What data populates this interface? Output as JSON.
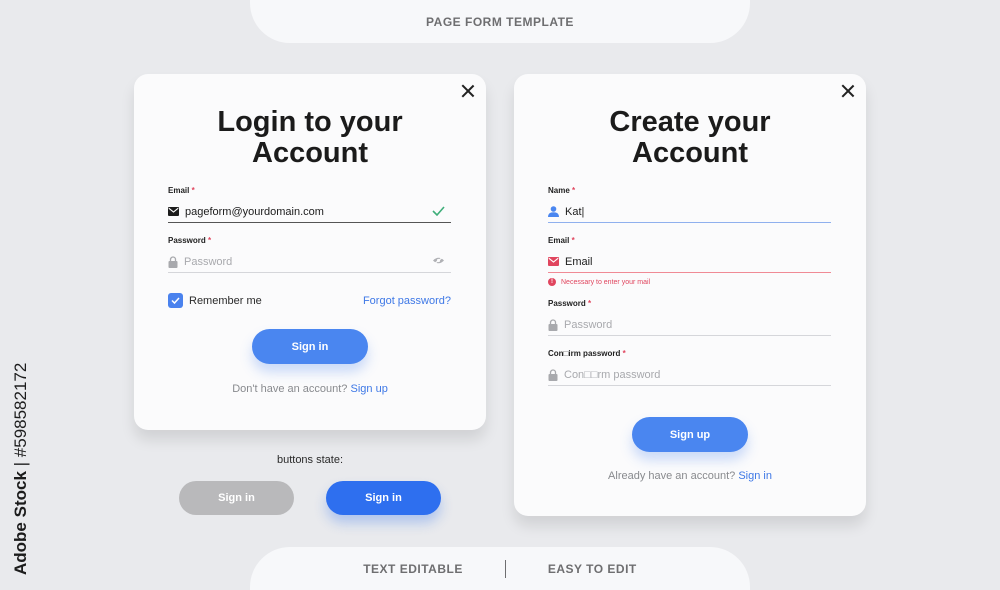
{
  "banners": {
    "top": "PAGE FORM TEMPLATE",
    "bottom_left": "TEXT EDITABLE",
    "bottom_right": "EASY TO EDIT"
  },
  "side_text": {
    "brand": "Adobe Stock",
    "id": "| #598582172"
  },
  "login": {
    "title_line1": "Login to your",
    "title_line2": "Account",
    "email_label": "Email",
    "email_value": "pageform@yourdomain.com",
    "password_label": "Password",
    "password_placeholder": "Password",
    "remember_label": "Remember me",
    "forgot_label": "Forgot password?",
    "signin_label": "Sign in",
    "footer_text": "Don't have an account?",
    "footer_link": "Sign up"
  },
  "buttons_state": {
    "label": "buttons state:",
    "disabled_label": "Sign in",
    "active_label": "Sign in"
  },
  "signup": {
    "title_line1": "Create your",
    "title_line2": "Account",
    "name_label": "Name",
    "name_value": "Kat|",
    "email_label": "Email",
    "email_value": "Email",
    "email_error": "Necessary to enter your mail",
    "password_label": "Password",
    "password_placeholder": "Password",
    "confirm_label": "Con□irm password",
    "confirm_placeholder": "Con□□rm password",
    "signup_label": "Sign up",
    "footer_text": "Already have an account?",
    "footer_link": "Sign in"
  },
  "colors": {
    "accent": "#4a86f0",
    "link": "#3e78e6",
    "error": "#e0455e",
    "success": "#3fae7a",
    "background": "#e9eaed"
  },
  "icons": {
    "close": "close-icon",
    "mail": "mail-icon",
    "check": "check-icon",
    "lock": "lock-icon",
    "eye": "eye-off-icon",
    "user": "user-icon",
    "error": "error-icon"
  }
}
